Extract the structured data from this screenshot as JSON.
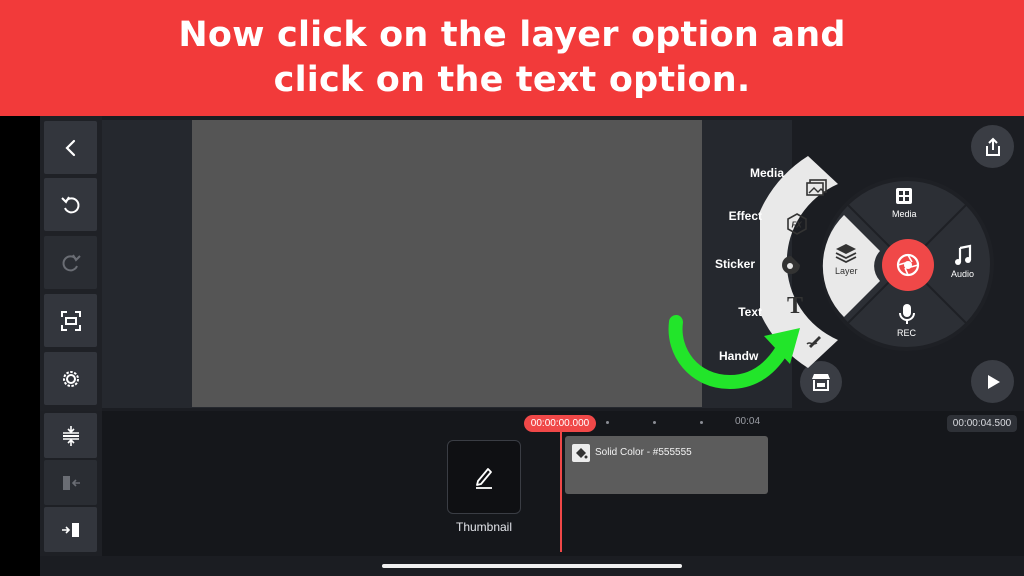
{
  "banner": {
    "line1": "Now click on the layer option and",
    "line2": "click on the text option."
  },
  "toolbar": {
    "back_icon": "back-chevron-icon",
    "undo_icon": "undo-icon",
    "redo_icon": "redo-icon",
    "screenshot_icon": "capture-frame-icon",
    "settings_icon": "gear-icon"
  },
  "layer_menu": {
    "items": [
      {
        "label": "Media",
        "icon": "image-icon"
      },
      {
        "label": "Effect",
        "icon": "fx-icon"
      },
      {
        "label": "Sticker",
        "icon": "sticker-icon"
      },
      {
        "label": "Text",
        "icon": "text-t-icon"
      },
      {
        "label": "Handwri",
        "icon": "handwriting-pen-icon"
      }
    ]
  },
  "wheel": {
    "media": "Media",
    "audio": "Audio",
    "rec": "REC",
    "layer": "Layer"
  },
  "timeline": {
    "current_time": "00:00:00.000",
    "marker_time": "00:04",
    "duration": "00:00:04.500",
    "thumbnail_label": "Thumbnail",
    "clip_label": "Solid Color - #555555"
  },
  "colors": {
    "banner": "#f23a3a",
    "accent": "#f04848",
    "arrow": "#22e52a",
    "canvas": "#555555"
  }
}
